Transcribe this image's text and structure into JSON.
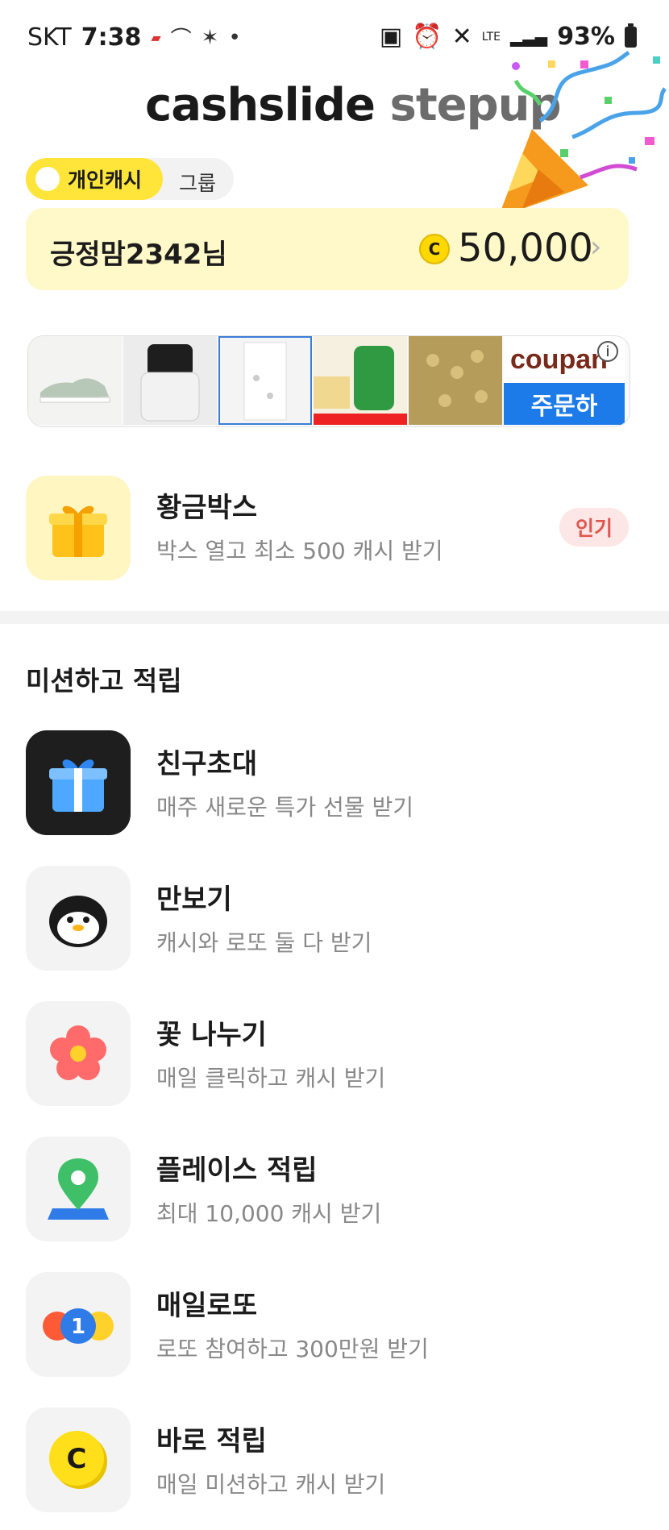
{
  "status_bar": {
    "carrier": "SKT",
    "time": "7:38",
    "battery": "93%",
    "network": "LTE"
  },
  "header": {
    "brand_part1": "cashslide",
    "brand_part2": "stepup"
  },
  "toggle": {
    "active_label": "개인캐시",
    "inactive_label": "그룹"
  },
  "cash_card": {
    "user_name": "긍정맘2342님",
    "coin_symbol": "C",
    "amount": "50,000"
  },
  "ad_banner": {
    "brand_text": "coupan",
    "button_text": "주문하",
    "info_symbol": "i"
  },
  "gold_box": {
    "title": "황금박스",
    "subtitle": "박스 열고 최소 500 캐시 받기",
    "badge": "인기"
  },
  "missions_section": {
    "title": "미션하고 적립",
    "items": [
      {
        "title": "친구초대",
        "subtitle": "매주 새로운 특가 선물 받기",
        "icon": "gift-icon"
      },
      {
        "title": "만보기",
        "subtitle": "캐시와 로또 둘 다 받기",
        "icon": "penguin-icon"
      },
      {
        "title": "꽃 나누기",
        "subtitle": "매일 클릭하고 캐시 받기",
        "icon": "flower-icon"
      },
      {
        "title": "플레이스 적립",
        "subtitle": "최대 10,000 캐시 받기",
        "icon": "map-pin-icon"
      },
      {
        "title": "매일로또",
        "subtitle": "로또 참여하고 300만원 받기",
        "icon": "lotto-balls-icon"
      },
      {
        "title": "바로 적립",
        "subtitle": "매일 미션하고 캐시 받기",
        "icon": "coin-icon"
      }
    ],
    "lotto_number": "1",
    "coin_letter": "C"
  },
  "colors": {
    "accent_yellow": "#ffe43a",
    "card_bg": "#fff8c8",
    "badge_text": "#e0554f"
  }
}
